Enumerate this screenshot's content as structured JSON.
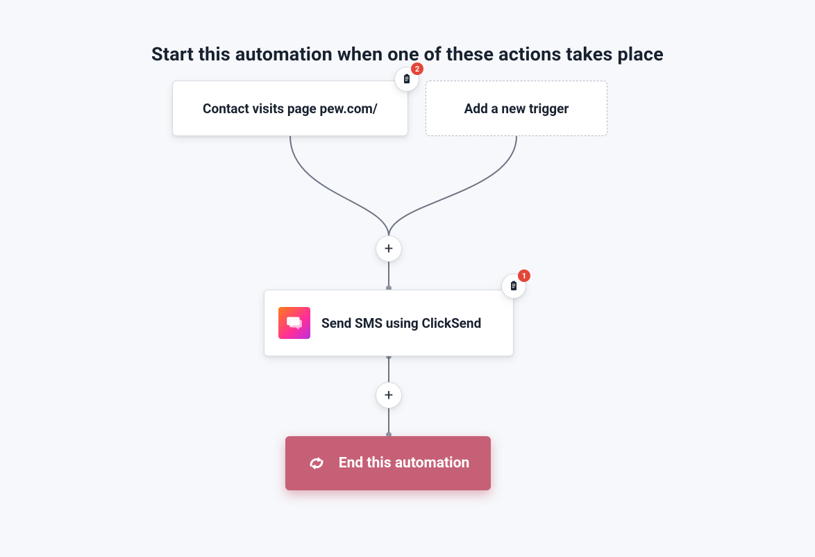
{
  "heading": "Start this automation when one of these actions takes place",
  "triggers": {
    "primary": {
      "label": "Contact visits page pew.com/",
      "note_count": "2"
    },
    "add": {
      "label": "Add a new trigger"
    }
  },
  "action": {
    "label": "Send SMS using ClickSend",
    "note_count": "1",
    "app_icon": "clicksend-chat-icon"
  },
  "end": {
    "label": "End this automation"
  },
  "plus": {
    "glyph": "+"
  },
  "colors": {
    "background": "#f6f8fb",
    "connector": "#6d7584",
    "badge": "#e34638",
    "end_bg": "#c66076"
  }
}
